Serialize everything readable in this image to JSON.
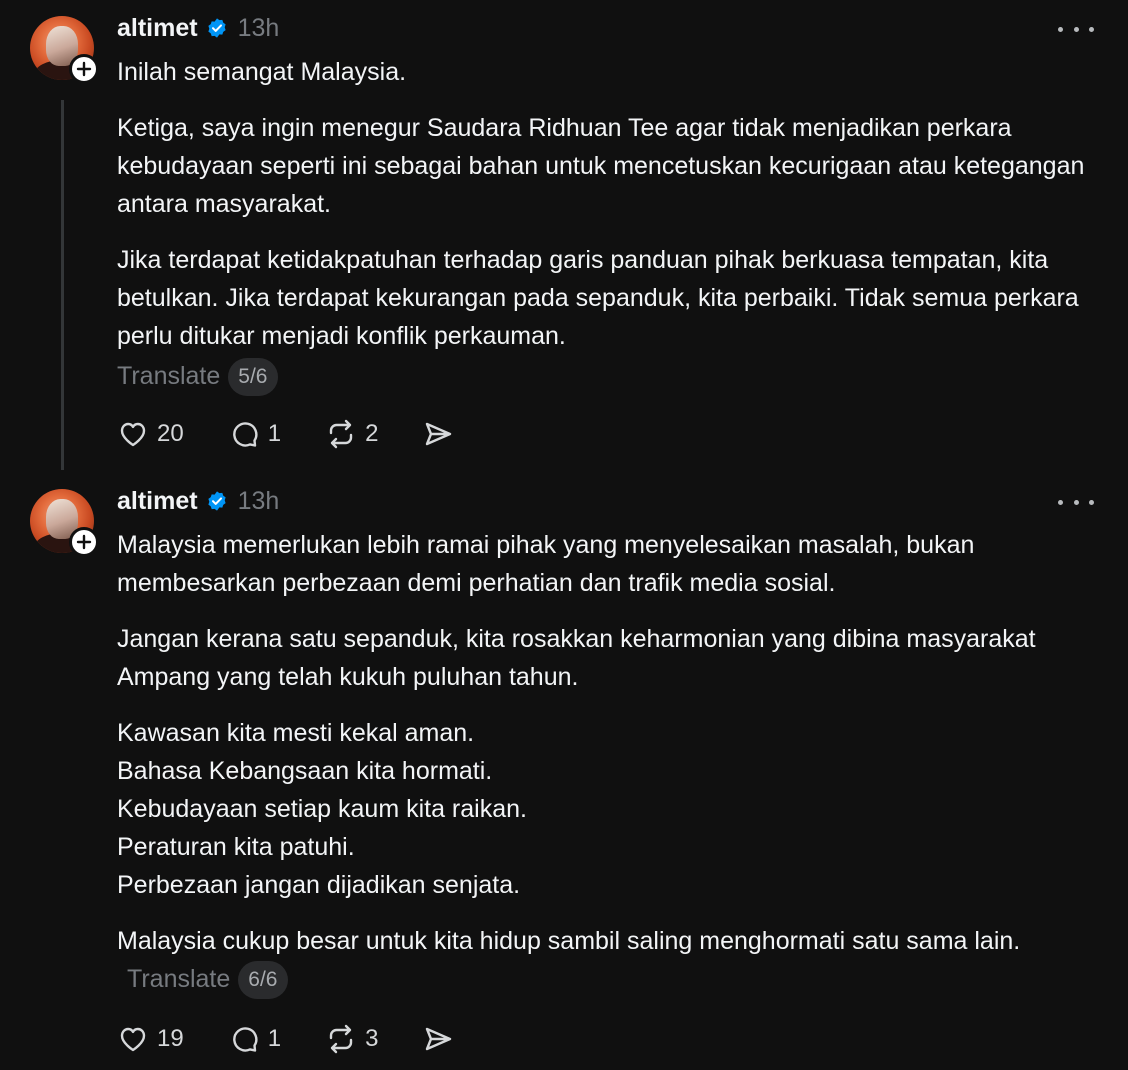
{
  "posts": [
    {
      "username": "altimet",
      "time": "13h",
      "paragraphs": [
        "Inilah semangat Malaysia.",
        "Ketiga, saya ingin menegur Saudara Ridhuan Tee agar tidak menjadikan perkara kebudayaan seperti ini sebagai bahan untuk mencetuskan kecurigaan atau ketegangan antara masyarakat.",
        "Jika terdapat ketidakpatuhan terhadap garis panduan pihak berkuasa tempatan, kita betulkan. Jika terdapat kekurangan pada sepanduk, kita perbaiki. Tidak semua perkara perlu ditukar menjadi konflik perkauman."
      ],
      "translate_label": "Translate",
      "page_indicator": "5/6",
      "likes": "20",
      "replies": "1",
      "reposts": "2"
    },
    {
      "username": "altimet",
      "time": "13h",
      "paragraphs": [
        "Malaysia memerlukan lebih ramai pihak yang menyelesaikan masalah, bukan membesarkan perbezaan demi perhatian dan trafik media sosial.",
        "Jangan kerana satu sepanduk, kita rosakkan keharmonian yang dibina masyarakat Ampang yang telah kukuh puluhan tahun."
      ],
      "lines": [
        "Kawasan kita mesti kekal aman.",
        "Bahasa Kebangsaan kita hormati.",
        "Kebudayaan setiap kaum kita raikan.",
        "Peraturan kita patuhi.",
        "Perbezaan jangan dijadikan senjata."
      ],
      "last_paragraph": "Malaysia cukup besar untuk kita hidup sambil saling menghormati satu sama lain.",
      "translate_label": "Translate",
      "page_indicator": "6/6",
      "likes": "19",
      "replies": "1",
      "reposts": "3"
    }
  ],
  "icons": {
    "verified": "verified-badge-icon",
    "more": "more-options-icon",
    "like": "heart-icon",
    "reply": "comment-icon",
    "repost": "repost-icon",
    "share": "share-icon",
    "follow": "plus-icon"
  },
  "colors": {
    "background": "#101010",
    "text": "#f3f5f7",
    "muted": "#777b80",
    "verified": "#0095f6"
  }
}
